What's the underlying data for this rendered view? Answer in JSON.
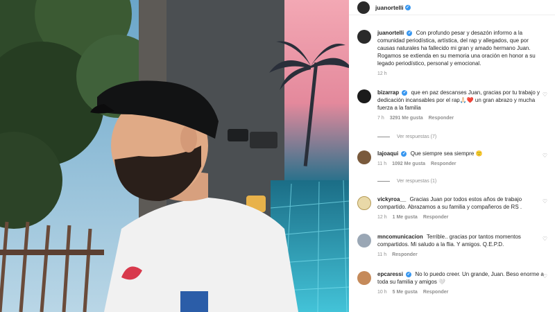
{
  "post": {
    "username": "juanortelli",
    "caption": "Con profundo pesar y desazón informo a la comunidad periodística, artística, del rap y allegados, que por causas naturales ha fallecido mi gran y amado hermano Juan. Rogamos se extienda en su memoria una oración en honor a su legado periodístico, personal y emocional.",
    "time": "12 h"
  },
  "comments": [
    {
      "user": "bizarrap",
      "verified": true,
      "text": "que en paz descanses Juan, gracias por tu trabajo y dedicación incansables por el rap🙏🏻❤️ un gran abrazo y mucha fuerza a la familia",
      "time": "7 h",
      "likes": "3291 Me gusta",
      "reply": "Responder",
      "view_replies": "Ver respuestas (7)"
    },
    {
      "user": "lajoaqui",
      "verified": true,
      "text": "Que siempre sea siempre 🙂",
      "time": "11 h",
      "likes": "1092 Me gusta",
      "reply": "Responder",
      "view_replies": "Ver respuestas (1)"
    },
    {
      "user": "vickyroa__",
      "verified": false,
      "text": "Gracias Juan por todos estos años de trabajo compartido. Abrazamos a su familia y compañeros de RS .",
      "time": "12 h",
      "likes": "1 Me gusta",
      "reply": "Responder"
    },
    {
      "user": "mncomunicacion",
      "verified": false,
      "text": "Terrible.. gracias por tantos momentos compartidos. Mi saludo a la flia. Y amigos. Q.E.P.D.",
      "time": "11 h",
      "reply": "Responder"
    },
    {
      "user": "epcaressi",
      "verified": true,
      "text": "No lo puedo creer. Un grande, Juan. Beso enorme a toda su familia y amigos 🤍",
      "time": "10 h",
      "likes": "5 Me gusta",
      "reply": "Responder"
    }
  ],
  "icons": {
    "like": "heart-outline-icon",
    "verified": "verified-badge-icon"
  }
}
